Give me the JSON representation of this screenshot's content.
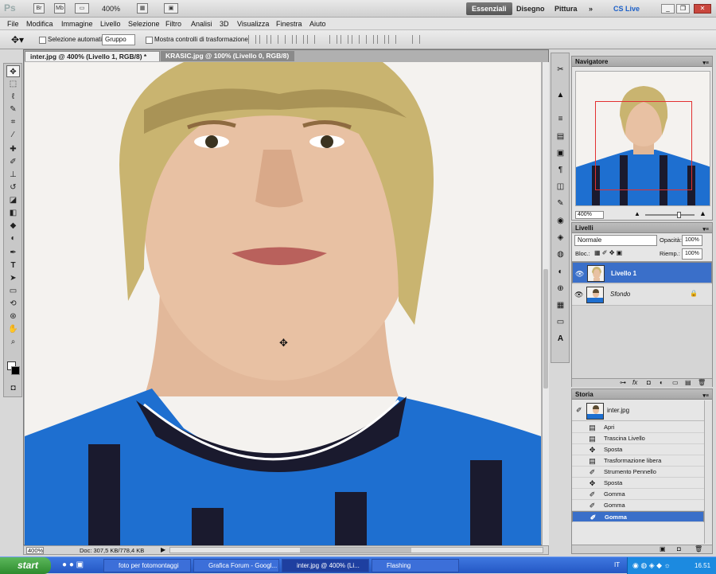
{
  "app": {
    "logo": "Ps",
    "zoom": "400%"
  },
  "workspaces": {
    "items": [
      "Essenziali",
      "Disegno",
      "Pittura"
    ],
    "more": "»",
    "cs_live": "CS Live"
  },
  "menu": [
    "File",
    "Modifica",
    "Immagine",
    "Livello",
    "Selezione",
    "Filtro",
    "Analisi",
    "3D",
    "Visualizza",
    "Finestra",
    "Aiuto"
  ],
  "options": {
    "auto_select_label": "Selezione automatica:",
    "auto_select_value": "Gruppo",
    "transform_label": "Mostra controlli di trasformazione"
  },
  "tabs": [
    "inter.jpg @ 400% (Livello 1, RGB/8) *",
    "KRASIC.jpg @ 100% (Livello 0, RGB/8) *"
  ],
  "status": {
    "zoom": "400%",
    "doc": "Doc: 307,5 KB/778,4 KB"
  },
  "navigator": {
    "title": "Navigatore",
    "zoom": "400%"
  },
  "layers": {
    "title": "Livelli",
    "blend_mode": "Normale",
    "opacity_label": "Opacità:",
    "opacity": "100%",
    "lock_label": "Bloc.:",
    "fill_label": "Riemp.:",
    "fill": "100%",
    "items": [
      {
        "name": "Livello 1"
      },
      {
        "name": "Sfondo"
      }
    ]
  },
  "history": {
    "title": "Storia",
    "snapshot": "inter.jpg",
    "items": [
      "Apri",
      "Trascina Livello",
      "Sposta",
      "Trasformazione libera",
      "Strumento Pennello",
      "Sposta",
      "Gomma",
      "Gomma",
      "Gomma"
    ]
  },
  "taskbar": {
    "start": "start",
    "tasks": [
      "foto per fotomontaggi",
      "Grafica Forum - Googl...",
      "inter.jpg @ 400% (Li...",
      "Flashing"
    ],
    "lang": "IT",
    "clock": "16.51"
  },
  "colors": {
    "selection": "#3a6fc9",
    "jersey_blue": "#1e6fd0",
    "jersey_black": "#1a1a2e"
  }
}
